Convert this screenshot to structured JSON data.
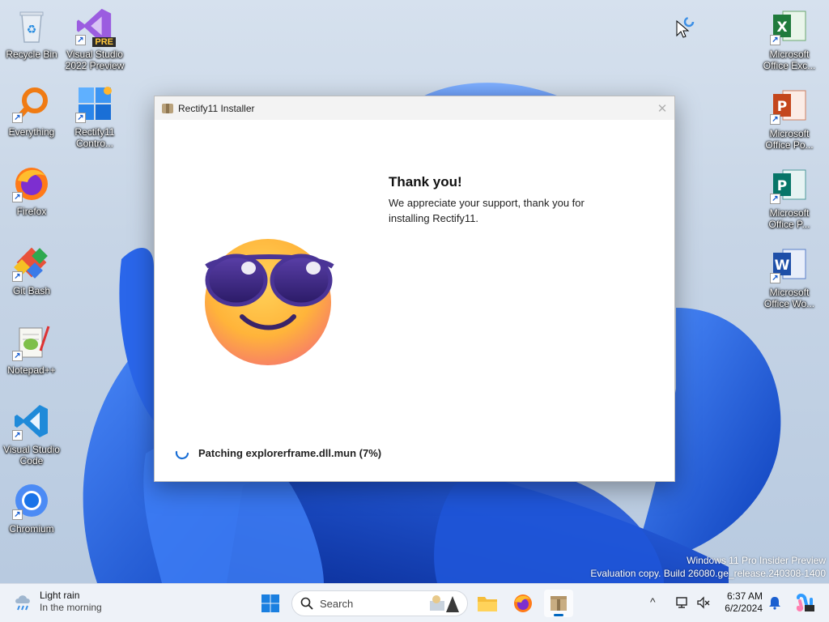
{
  "desktop_icons": [
    {
      "name": "recycle-bin",
      "label": "Recycle Bin",
      "icon": "recycle-bin-icon"
    },
    {
      "name": "visual-studio-2022-preview",
      "label": "Visual Studio\n2022 Preview",
      "icon": "visual-studio-icon",
      "badge": "PRE"
    },
    {
      "name": "everything",
      "label": "Everything",
      "icon": "magnifier-icon"
    },
    {
      "name": "rectify11-control",
      "label": "Rectify11\nContro...",
      "icon": "control-panel-icon"
    },
    {
      "name": "firefox",
      "label": "Firefox",
      "icon": "firefox-icon"
    },
    {
      "name": "git-bash",
      "label": "Git Bash",
      "icon": "git-icon"
    },
    {
      "name": "notepad-plus-plus",
      "label": "Notepad++",
      "icon": "notepad-icon"
    },
    {
      "name": "visual-studio-code",
      "label": "Visual Studio\nCode",
      "icon": "vscode-icon"
    },
    {
      "name": "chromium",
      "label": "Chromium",
      "icon": "chromium-icon"
    },
    {
      "name": "ms-office-excel",
      "label": "Microsoft\nOffice Exc...",
      "icon": "excel-icon"
    },
    {
      "name": "ms-office-powerpoint",
      "label": "Microsoft\nOffice Po...",
      "icon": "powerpoint-icon"
    },
    {
      "name": "ms-office-publisher",
      "label": "Microsoft\nOffice P...",
      "icon": "publisher-icon"
    },
    {
      "name": "ms-office-word",
      "label": "Microsoft\nOffice Wo...",
      "icon": "word-icon"
    }
  ],
  "window": {
    "title": "Rectify11 Installer",
    "close_glyph": "✕",
    "heading": "Thank you!",
    "message": "We appreciate your support, thank you for installing Rectify11.",
    "status": "Patching explorerframe.dll.mun (7%)",
    "progress_percent": 7
  },
  "watermark": {
    "line1": "Windows 11 Pro Insider Preview",
    "line2": "Evaluation copy. Build 26080.ge_release.240308-1400"
  },
  "taskbar": {
    "weather_title": "Light rain",
    "weather_subtitle": "In the morning",
    "search_placeholder": "Search",
    "time": "6:37 AM",
    "date": "6/2/2024",
    "tray_chevron": "^"
  },
  "colors": {
    "accent": "#0067c0",
    "wallpaper_blue": "#1b5fd9"
  }
}
